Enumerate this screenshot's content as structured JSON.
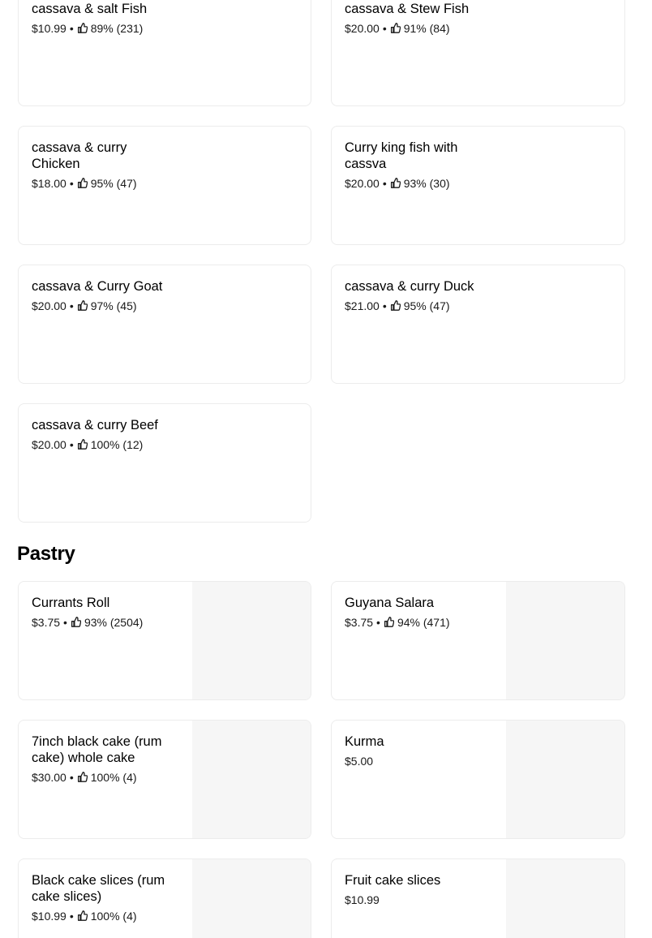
{
  "upper_items": [
    {
      "name": "cassava & salt Fish",
      "price": "$10.99",
      "rating": "89% (231)"
    },
    {
      "name": "cassava & Stew Fish",
      "price": "$20.00",
      "rating": "91% (84)"
    },
    {
      "name": "cassava & curry Chicken",
      "price": "$18.00",
      "rating": "95% (47)"
    },
    {
      "name": "Curry king fish  with cassva",
      "price": "$20.00",
      "rating": "93% (30)"
    },
    {
      "name": "cassava & Curry Goat",
      "price": "$20.00",
      "rating": "97% (45)"
    },
    {
      "name": "cassava & curry Duck",
      "price": "$21.00",
      "rating": "95% (47)"
    },
    {
      "name": "cassava & curry Beef",
      "price": "$20.00",
      "rating": "100% (12)"
    }
  ],
  "pastry_section": {
    "title": "Pastry",
    "items": [
      {
        "name": "Currants Roll",
        "price": "$3.75",
        "rating": "93% (2504)"
      },
      {
        "name": "Guyana Salara",
        "price": "$3.75",
        "rating": "94% (471)"
      },
      {
        "name": "7inch black cake (rum cake)  whole cake",
        "price": "$30.00",
        "rating": "100% (4)"
      },
      {
        "name": "Kurma",
        "price": "$5.00"
      },
      {
        "name": "Black cake slices (rum cake slices)",
        "price": "$10.99",
        "rating": "100% (4)"
      },
      {
        "name": "Fruit cake slices",
        "price": "$10.99"
      }
    ]
  },
  "separator": "•",
  "image_placeholder_color": "#f6f6f6"
}
